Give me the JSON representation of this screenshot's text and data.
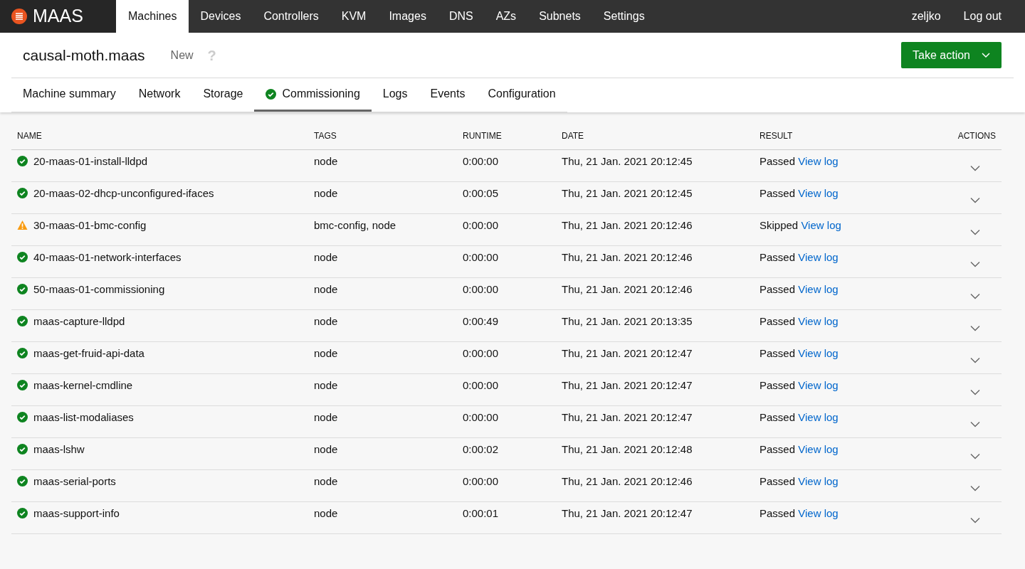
{
  "nav": {
    "logo": "MAAS",
    "items": [
      {
        "label": "Machines",
        "selected": true
      },
      {
        "label": "Devices",
        "selected": false
      },
      {
        "label": "Controllers",
        "selected": false
      },
      {
        "label": "KVM",
        "selected": false
      },
      {
        "label": "Images",
        "selected": false
      },
      {
        "label": "DNS",
        "selected": false
      },
      {
        "label": "AZs",
        "selected": false
      },
      {
        "label": "Subnets",
        "selected": false
      },
      {
        "label": "Settings",
        "selected": false
      }
    ],
    "user": "zeljko",
    "logout": "Log out"
  },
  "header": {
    "title": "causal-moth.maas",
    "status": "New",
    "help": "?",
    "action": "Take action"
  },
  "tabs": [
    {
      "label": "Machine summary",
      "selected": false,
      "passed": false
    },
    {
      "label": "Network",
      "selected": false,
      "passed": false
    },
    {
      "label": "Storage",
      "selected": false,
      "passed": false
    },
    {
      "label": "Commissioning",
      "selected": true,
      "passed": true
    },
    {
      "label": "Logs",
      "selected": false,
      "passed": false
    },
    {
      "label": "Events",
      "selected": false,
      "passed": false
    },
    {
      "label": "Configuration",
      "selected": false,
      "passed": false
    }
  ],
  "table": {
    "columns": [
      "NAME",
      "TAGS",
      "RUNTIME",
      "DATE",
      "RESULT",
      "ACTIONS"
    ],
    "rows": [
      {
        "kind": "passed",
        "name": "20-maas-01-install-lldpd",
        "tags": "node",
        "runtime": "0:00:00",
        "date": "Thu, 21 Jan. 2021 20:12:45",
        "result": "Passed",
        "link": "View log"
      },
      {
        "kind": "passed",
        "name": "20-maas-02-dhcp-unconfigured-ifaces",
        "tags": "node",
        "runtime": "0:00:05",
        "date": "Thu, 21 Jan. 2021 20:12:45",
        "result": "Passed",
        "link": "View log"
      },
      {
        "kind": "warning",
        "name": "30-maas-01-bmc-config",
        "tags": "bmc-config, node",
        "runtime": "0:00:00",
        "date": "Thu, 21 Jan. 2021 20:12:46",
        "result": "Skipped",
        "link": "View log"
      },
      {
        "kind": "passed",
        "name": "40-maas-01-network-interfaces",
        "tags": "node",
        "runtime": "0:00:00",
        "date": "Thu, 21 Jan. 2021 20:12:46",
        "result": "Passed",
        "link": "View log"
      },
      {
        "kind": "passed",
        "name": "50-maas-01-commissioning",
        "tags": "node",
        "runtime": "0:00:00",
        "date": "Thu, 21 Jan. 2021 20:12:46",
        "result": "Passed",
        "link": "View log"
      },
      {
        "kind": "passed",
        "name": "maas-capture-lldpd",
        "tags": "node",
        "runtime": "0:00:49",
        "date": "Thu, 21 Jan. 2021 20:13:35",
        "result": "Passed",
        "link": "View log"
      },
      {
        "kind": "passed",
        "name": "maas-get-fruid-api-data",
        "tags": "node",
        "runtime": "0:00:00",
        "date": "Thu, 21 Jan. 2021 20:12:47",
        "result": "Passed",
        "link": "View log"
      },
      {
        "kind": "passed",
        "name": "maas-kernel-cmdline",
        "tags": "node",
        "runtime": "0:00:00",
        "date": "Thu, 21 Jan. 2021 20:12:47",
        "result": "Passed",
        "link": "View log"
      },
      {
        "kind": "passed",
        "name": "maas-list-modaliases",
        "tags": "node",
        "runtime": "0:00:00",
        "date": "Thu, 21 Jan. 2021 20:12:47",
        "result": "Passed",
        "link": "View log"
      },
      {
        "kind": "passed",
        "name": "maas-lshw",
        "tags": "node",
        "runtime": "0:00:02",
        "date": "Thu, 21 Jan. 2021 20:12:48",
        "result": "Passed",
        "link": "View log"
      },
      {
        "kind": "passed",
        "name": "maas-serial-ports",
        "tags": "node",
        "runtime": "0:00:00",
        "date": "Thu, 21 Jan. 2021 20:12:46",
        "result": "Passed",
        "link": "View log"
      },
      {
        "kind": "passed",
        "name": "maas-support-info",
        "tags": "node",
        "runtime": "0:00:01",
        "date": "Thu, 21 Jan. 2021 20:12:47",
        "result": "Passed",
        "link": "View log"
      }
    ]
  }
}
